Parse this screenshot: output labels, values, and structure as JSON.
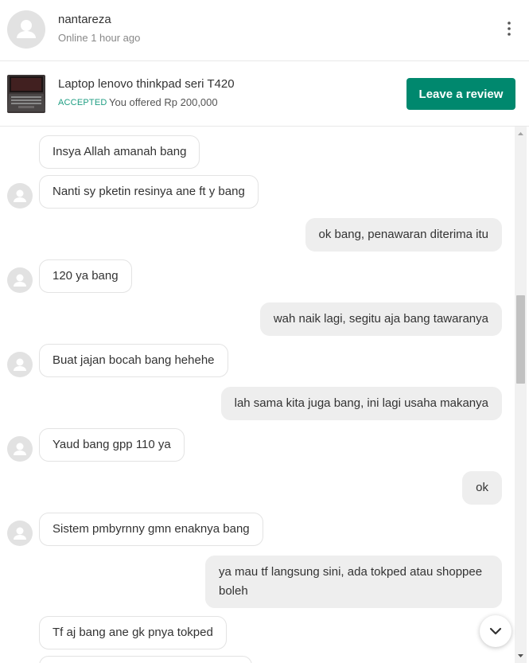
{
  "header": {
    "username": "nantareza",
    "status": "Online 1 hour ago"
  },
  "product": {
    "title": "Laptop lenovo thinkpad seri T420",
    "status_badge": "ACCEPTED",
    "offer_text": "You offered Rp 200,000",
    "review_button": "Leave a review"
  },
  "messages": [
    {
      "side": "in",
      "text": "Insya Allah amanah bang"
    },
    {
      "side": "in",
      "text": "Nanti sy pketin resinya ane ft y bang"
    },
    {
      "side": "out",
      "text": "ok bang, penawaran diterima itu"
    },
    {
      "side": "in",
      "text": "120 ya bang"
    },
    {
      "side": "out",
      "text": "wah naik lagi, segitu aja bang tawaranya"
    },
    {
      "side": "in",
      "text": "Buat jajan bocah bang hehehe"
    },
    {
      "side": "out",
      "text": "lah sama kita juga bang, ini lagi usaha makanya"
    },
    {
      "side": "in",
      "text": "Yaud bang gpp 110 ya"
    },
    {
      "side": "out",
      "text": "ok"
    },
    {
      "side": "in",
      "text": "Sistem pmbyrnny gmn enaknya bang"
    },
    {
      "side": "out",
      "text": "ya mau tf langsung sini, ada tokped atau shoppee boleh"
    },
    {
      "side": "in",
      "text": "Tf aj bang ane gk pnya tokped"
    }
  ],
  "colors": {
    "accent": "#00886e",
    "accepted": "#1f9e83",
    "outgoing_bubble": "#eeeeee",
    "incoming_border": "#e3e3e3"
  },
  "icons": {
    "user_avatar": "person-icon",
    "menu": "vertical-dots-icon",
    "scroll_bottom": "chevron-down-icon"
  }
}
